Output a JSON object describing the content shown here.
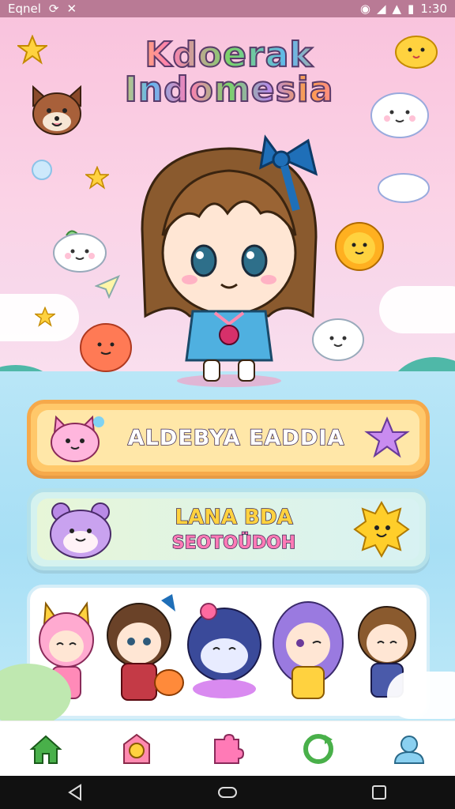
{
  "status_bar": {
    "carrier": "Eqnel",
    "time": "1:30"
  },
  "app": {
    "title_line1": "Kdoerak",
    "title_line2": "Indomesia"
  },
  "menu": {
    "button1_label": "ALDEBYA EADDIA",
    "button2_line1": "LANA BDA",
    "button2_line2": "SEOTOÜDOH"
  },
  "bottom_nav": {
    "items": [
      "home-icon",
      "badge-icon",
      "puzzle-icon",
      "refresh-icon",
      "profile-icon"
    ]
  },
  "colors": {
    "accent_pink": "#f9c3dd",
    "sky_blue": "#a7dff5",
    "button_orange": "#ffc86a",
    "button_mint": "#d5f2ef",
    "nav_green": "#49b04a"
  }
}
